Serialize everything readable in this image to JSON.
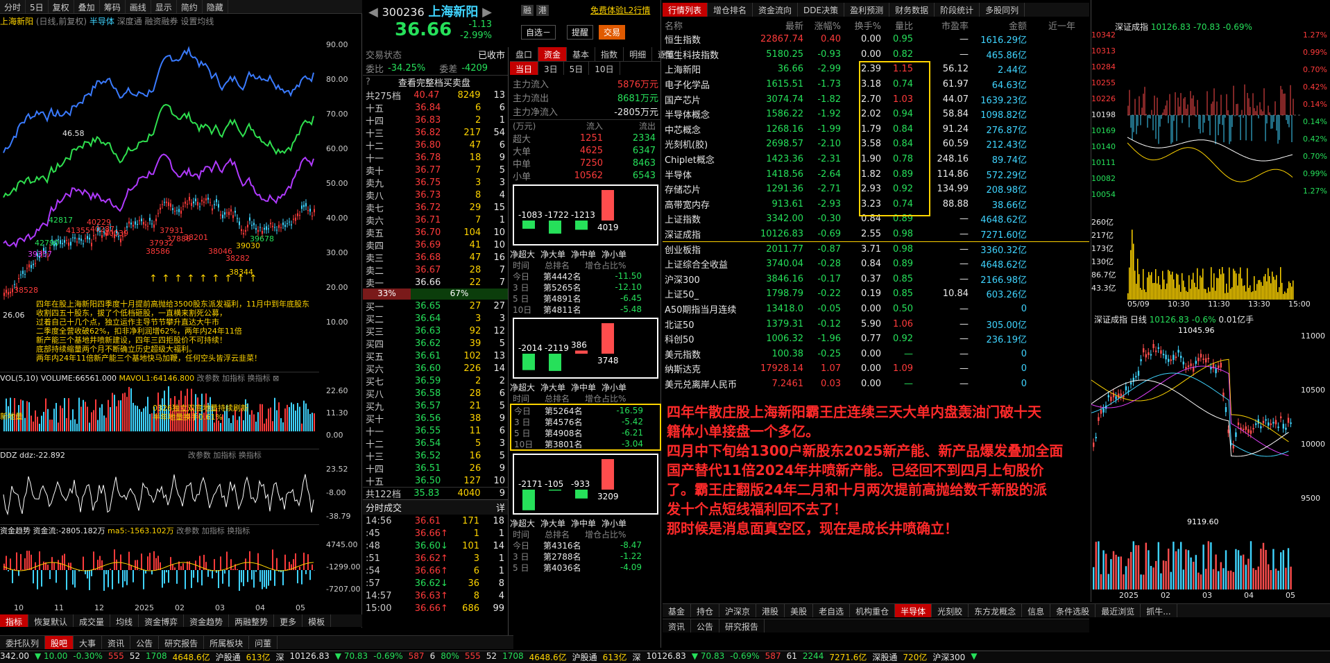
{
  "left": {
    "toolbar": [
      "分时",
      "5日",
      "复权",
      "叠加",
      "筹码",
      "画线",
      "显示",
      "简约",
      "隐藏"
    ],
    "header": {
      "title": "上海新阳",
      "mode": "(日线,前复权)",
      "concept": "半导体",
      "tabs": [
        "深度通",
        "融资融券",
        "设置均线"
      ]
    },
    "yaxis": [
      "90.00",
      "80.00",
      "70.00",
      "60.00",
      "50.00",
      "40.00",
      "30.00",
      "20.00",
      "10.00"
    ],
    "price_labels": [
      {
        "t": "46.58",
        "c": "w"
      },
      {
        "t": "42817",
        "c": "g"
      },
      {
        "t": "41355",
        "c": "r"
      },
      {
        "t": "40287",
        "c": "r"
      },
      {
        "t": "40229",
        "c": "r"
      },
      {
        "t": "40039",
        "c": "r"
      },
      {
        "t": "42790",
        "c": "g"
      },
      {
        "t": "39357",
        "c": "m"
      },
      {
        "t": "38528",
        "c": "r"
      },
      {
        "t": "38586",
        "c": "r"
      },
      {
        "t": "37932",
        "c": "r"
      },
      {
        "t": "37886",
        "c": "r"
      },
      {
        "t": "38201",
        "c": "r"
      },
      {
        "t": "38046",
        "c": "r"
      },
      {
        "t": "38282",
        "c": "r"
      },
      {
        "t": "39030",
        "c": "y"
      },
      {
        "t": "38344",
        "c": "y"
      },
      {
        "t": "39678",
        "c": "g"
      },
      {
        "t": "26.06",
        "c": "w"
      },
      {
        "t": "37931",
        "c": "r"
      }
    ],
    "annotation": [
      "四年在股上海新阳四季度十月提前高抛给3500股东派发福利，11月中到年底股东收割四五十股东，拔了个低档砸股，一直横来割死公募，",
      "过着自己十几个点，独立运作主导节节攀升直达大牛市",
      "二季度全营收破62%，扣非净利润增62%，两年内24年11倍",
      "新产能三个基地井喷新建设，四年三四拒股价不可持续！",
      "底部持续缩量两个月不断确立历史超级大福利。",
      "两年内24年11倍新产能三个基地快马加鞭，任何空头皆浮云韭菜！"
    ],
    "vol": {
      "label": "VOL(5,10)",
      "volume": "VOLUME:66561.000",
      "mavol": "MAVOL1:64146.800",
      "tools": [
        "改参数",
        "加指标",
        "换指标"
      ],
      "y": [
        "22.60",
        "11.30",
        "0.00"
      ],
      "note1": "0326独立双底地量持续刷新",
      "note2": "半年地量换手0.61%",
      "side": "新地量"
    },
    "ddz": {
      "label": "DDZ",
      "val": "ddz:-22.892",
      "tools": [
        "改参数",
        "加指标",
        "换指标"
      ],
      "y": [
        "23.52",
        "-8.00",
        "-38.79"
      ]
    },
    "fund": {
      "label": "资金趋势",
      "val": "资金流:-2805.182万",
      "ma": "ma5:-1563.102万",
      "tools": [
        "改参数",
        "加指标",
        "换指标"
      ],
      "y": [
        "4745.00",
        "-1299.00",
        "-7207.00"
      ]
    },
    "xaxis": [
      "10",
      "11",
      "12",
      "2025",
      "02",
      "03",
      "04",
      "05"
    ],
    "tabs": [
      "指标",
      "恢复默认",
      "成交量",
      "均线",
      "资金博弈",
      "资金趋势",
      "两融整势",
      "更多",
      "模板"
    ]
  },
  "mid": {
    "code": "300236",
    "name": "上海新阳",
    "price": "36.66",
    "change": "-1.13",
    "pct": "-2.99%",
    "tags": [
      "融",
      "港"
    ],
    "free_link": "免费体验L2行情",
    "buttons": [
      "自选－",
      "提醒",
      "交易"
    ],
    "state_label": "交易状态",
    "state": "已收市",
    "wb_label": "委比",
    "wb": "-34.25%",
    "wc_label": "委差",
    "wc": "-4209",
    "tabs": [
      "盘口",
      "资金",
      "基本",
      "指数",
      "明细",
      "逐笔"
    ],
    "view_full": "查看完整档买卖盘",
    "sell_total": {
      "label": "共275档",
      "price": "40.47",
      "vol": "8249",
      "cnt": "13"
    },
    "sells": [
      [
        "十五",
        "36.84",
        "6",
        "6"
      ],
      [
        "十四",
        "36.83",
        "2",
        "1"
      ],
      [
        "十三",
        "36.82",
        "217",
        "54"
      ],
      [
        "十二",
        "36.80",
        "47",
        "6"
      ],
      [
        "十一",
        "36.78",
        "18",
        "9"
      ],
      [
        "卖十",
        "36.77",
        "7",
        "5"
      ],
      [
        "卖九",
        "36.75",
        "3",
        "3"
      ],
      [
        "卖八",
        "36.73",
        "8",
        "4"
      ],
      [
        "卖七",
        "36.72",
        "29",
        "15"
      ],
      [
        "卖六",
        "36.71",
        "7",
        "1"
      ],
      [
        "卖五",
        "36.70",
        "104",
        "10"
      ],
      [
        "卖四",
        "36.69",
        "41",
        "10"
      ],
      [
        "卖三",
        "36.68",
        "47",
        "16"
      ],
      [
        "卖二",
        "36.67",
        "28",
        "7"
      ],
      [
        "卖一",
        "36.66",
        "22",
        "7"
      ]
    ],
    "ratio": [
      "33%",
      "67%"
    ],
    "buys": [
      [
        "买一",
        "36.65",
        "27",
        "27"
      ],
      [
        "买二",
        "36.64",
        "3",
        "3"
      ],
      [
        "买三",
        "36.63",
        "92",
        "12"
      ],
      [
        "买四",
        "36.62",
        "39",
        "5"
      ],
      [
        "买五",
        "36.61",
        "102",
        "13"
      ],
      [
        "买六",
        "36.60",
        "226",
        "14"
      ],
      [
        "买七",
        "36.59",
        "2",
        "2"
      ],
      [
        "买八",
        "36.58",
        "28",
        "6"
      ],
      [
        "买九",
        "36.57",
        "21",
        "5"
      ],
      [
        "买十",
        "36.56",
        "38",
        "9"
      ],
      [
        "十一",
        "36.55",
        "11",
        "6"
      ],
      [
        "十二",
        "36.54",
        "5",
        "3"
      ],
      [
        "十三",
        "36.52",
        "16",
        "5"
      ],
      [
        "十四",
        "36.51",
        "26",
        "9"
      ],
      [
        "十五",
        "36.50",
        "127",
        "10"
      ]
    ],
    "buy_total": {
      "label": "共122档",
      "price": "35.83",
      "vol": "4040",
      "cnt": "9"
    },
    "ticks_title": "分时成交",
    "ticks_btn": "详",
    "ticks": [
      [
        "14:56",
        "36.61",
        "",
        "171",
        "18"
      ],
      [
        ":45",
        "36.66",
        "↑",
        "1",
        "1"
      ],
      [
        ":48",
        "36.60",
        "↓",
        "101",
        "14"
      ],
      [
        ":51",
        "36.62",
        "↑",
        "3",
        "1"
      ],
      [
        ":54",
        "36.66",
        "↑",
        "6",
        "1"
      ],
      [
        ":57",
        "36.62",
        "↓",
        "36",
        "8"
      ],
      [
        "14:57",
        "36.63",
        "↑",
        "8",
        "4"
      ],
      [
        "15:00",
        "36.66",
        "↑",
        "686",
        "99"
      ]
    ],
    "fund": {
      "periods": [
        "当日",
        "3日",
        "5日",
        "10日"
      ],
      "flows": [
        [
          "主力流入",
          "5876万元",
          "r"
        ],
        [
          "主力流出",
          "8681万元",
          "g"
        ],
        [
          "主力净流入",
          "-2805万元",
          "w"
        ]
      ],
      "unit": "(万元)",
      "cols": [
        "流入",
        "流出"
      ],
      "rows": [
        [
          "超大",
          "1251",
          "2334"
        ],
        [
          "大单",
          "4625",
          "6347"
        ],
        [
          "中单",
          "7250",
          "8463"
        ],
        [
          "小单",
          "10562",
          "6543"
        ]
      ],
      "bar_labels": [
        "净超大",
        "净大单",
        "净中单",
        "净小单"
      ],
      "bars1": [
        {
          "v": "-1083",
          "n": -1083
        },
        {
          "v": "-1722",
          "n": -1722
        },
        {
          "v": "-1213",
          "n": -1213
        },
        {
          "v": "4019",
          "n": 4019
        }
      ],
      "rank_hdr": [
        "时间",
        "总排名",
        "增仓占比%"
      ],
      "rank1": [
        [
          "今日",
          "第4442名",
          "-11.50"
        ],
        [
          "3 日",
          "第5265名",
          "-12.10"
        ],
        [
          "5 日",
          "第4891名",
          "-6.45"
        ],
        [
          "10日",
          "第4811名",
          "-5.48"
        ]
      ],
      "bars2": [
        {
          "v": "-2014",
          "n": -2014
        },
        {
          "v": "-2119",
          "n": -2119
        },
        {
          "v": "386",
          "n": 386
        },
        {
          "v": "3748",
          "n": 3748
        }
      ],
      "rank2": [
        [
          "今日",
          "第5264名",
          "-16.59"
        ],
        [
          "3 日",
          "第4576名",
          "-5.42"
        ],
        [
          "5 日",
          "第4908名",
          "-6.21"
        ],
        [
          "10日",
          "第3801名",
          "-3.04"
        ]
      ],
      "bars3": [
        {
          "v": "-2171",
          "n": -2171
        },
        {
          "v": "-105",
          "n": -105
        },
        {
          "v": "-933",
          "n": -933
        },
        {
          "v": "3209",
          "n": 3209
        }
      ],
      "rank3": [
        [
          "今日",
          "第4316名",
          "-8.47"
        ],
        [
          "3 日",
          "第2788名",
          "-1.22"
        ],
        [
          "5 日",
          "第4036名",
          "-4.09"
        ]
      ]
    }
  },
  "table": {
    "tabs": [
      "行情列表",
      "增仓排名",
      "资金流向",
      "DDE决策",
      "盈利预测",
      "财务数据",
      "阶段统计",
      "多股同列"
    ],
    "headers": [
      "名称",
      "最新",
      "涨幅%",
      "换手%",
      "量比",
      "市盈率",
      "金额",
      "近一年"
    ],
    "rows": [
      [
        "恒生指数",
        "22867.74",
        "0.40",
        "0.00",
        "0.95",
        "—",
        "1616.29亿",
        "r"
      ],
      [
        "恒生科技指数",
        "5180.25",
        "-0.93",
        "0.00",
        "0.82",
        "—",
        "465.86亿",
        "g"
      ],
      [
        "上海新阳",
        "36.66",
        "-2.99",
        "2.39",
        "1.15",
        "56.12",
        "2.44亿",
        "g"
      ],
      [
        "电子化学品",
        "1615.51",
        "-1.73",
        "3.18",
        "0.74",
        "61.97",
        "64.63亿",
        "g"
      ],
      [
        "国产芯片",
        "3074.74",
        "-1.82",
        "2.70",
        "1.03",
        "44.07",
        "1639.23亿",
        "g"
      ],
      [
        "半导体概念",
        "1586.22",
        "-1.92",
        "2.02",
        "0.94",
        "58.84",
        "1098.82亿",
        "g"
      ],
      [
        "中芯概念",
        "1268.16",
        "-1.99",
        "1.79",
        "0.84",
        "91.24",
        "276.87亿",
        "g"
      ],
      [
        "光刻机(胶)",
        "2698.57",
        "-2.10",
        "3.58",
        "0.84",
        "60.59",
        "212.43亿",
        "g"
      ],
      [
        "Chiplet概念",
        "1423.36",
        "-2.31",
        "1.90",
        "0.78",
        "248.16",
        "89.74亿",
        "g"
      ],
      [
        "半导体",
        "1418.56",
        "-2.64",
        "1.82",
        "0.89",
        "114.86",
        "572.29亿",
        "g"
      ],
      [
        "存储芯片",
        "1291.36",
        "-2.71",
        "2.93",
        "0.92",
        "134.99",
        "208.98亿",
        "g"
      ],
      [
        "高带宽内存",
        "913.61",
        "-2.93",
        "3.23",
        "0.74",
        "88.88",
        "38.66亿",
        "g"
      ],
      [
        "上证指数",
        "3342.00",
        "-0.30",
        "0.84",
        "0.89",
        "—",
        "4648.62亿",
        "g"
      ],
      [
        "深证成指",
        "10126.83",
        "-0.69",
        "2.55",
        "0.98",
        "—",
        "7271.60亿",
        "g"
      ],
      [
        "创业板指",
        "2011.77",
        "-0.87",
        "3.71",
        "0.98",
        "—",
        "3360.32亿",
        "g"
      ],
      [
        "上证综合全收益",
        "3740.04",
        "-0.28",
        "0.84",
        "0.89",
        "—",
        "4648.62亿",
        "g"
      ],
      [
        "沪深300",
        "3846.16",
        "-0.17",
        "0.37",
        "0.85",
        "—",
        "2166.98亿",
        "g"
      ],
      [
        "上证50_",
        "1798.79",
        "-0.22",
        "0.19",
        "0.85",
        "10.84",
        "603.26亿",
        "g"
      ],
      [
        "A50期指当月连续",
        "13418.0",
        "-0.05",
        "0.00",
        "0.50",
        "—",
        "0",
        "g"
      ],
      [
        "北证50",
        "1379.31",
        "-0.12",
        "5.90",
        "1.06",
        "—",
        "305.00亿",
        "g"
      ],
      [
        "科创50",
        "1006.32",
        "-1.96",
        "0.77",
        "0.92",
        "—",
        "236.19亿",
        "g"
      ],
      [
        "美元指数",
        "100.38",
        "-0.25",
        "0.00",
        "—",
        "—",
        "0",
        "g"
      ],
      [
        "纳斯达克",
        "17928.14",
        "1.07",
        "0.00",
        "1.09",
        "—",
        "0",
        "r"
      ],
      [
        "美元兑离岸人民币",
        "7.2461",
        "0.03",
        "0.00",
        "—",
        "—",
        "0",
        "r"
      ]
    ],
    "note": [
      "四年牛散庄股上海新阳霸王庄连续三天大单内盘轰油门破十天",
      "籍体小单接盘一个多亿。",
      "四月中下旬给1300户新股东2025新产能、新产品爆发叠加全面",
      "国产替代11倍2024年井喷新产能。已经回不到四月上旬股价",
      "了。霸王庄翻版24年二月和十月两次提前高抛给数千新股的派",
      "发十个点短线福利回不去了！",
      "那时候是消息面真空区，现在是成长井喷确立！"
    ],
    "bottom_tabs": [
      "基金",
      "持仓",
      "沪深京",
      "港股",
      "美股",
      "老自选",
      "机构重仓",
      "半导体",
      "光刻胶",
      "东方龙概念",
      "信息",
      "条件选股",
      "最近浏览",
      "抓牛..."
    ],
    "sub_tabs": [
      "资讯",
      "公告",
      "研究报告"
    ]
  },
  "right": {
    "title": "深证成指",
    "price": "10126.83",
    "chg": "-70.83",
    "pct": "-0.69%",
    "yleft": [
      "10342",
      "10313",
      "10284",
      "10255",
      "10226",
      "10198",
      "10169",
      "10140",
      "10111",
      "10082",
      "10054"
    ],
    "yright": [
      "1.27%",
      "0.99%",
      "0.70%",
      "0.42%",
      "0.14%",
      "0.14%",
      "0.42%",
      "0.70%",
      "0.99%",
      "1.27%"
    ],
    "vol_y": [
      "260亿",
      "217亿",
      "173亿",
      "130亿",
      "86.7亿",
      "43.3亿"
    ],
    "xaxis": [
      "05/09",
      "10:30",
      "11:30",
      "13:30",
      "15:00"
    ],
    "day_title": "深证成指 日线",
    "day_price": "10126.83",
    "day_chg": "-0.6%",
    "day_amt": "0.01亿手",
    "day_y": [
      "11000",
      "10500",
      "10000",
      "9500"
    ],
    "hi": "11045.96",
    "lo": "9119.60",
    "day_x": [
      "2025",
      "02",
      "03",
      "04",
      "05"
    ]
  },
  "status": {
    "bottom_tabs": [
      "委托队列",
      "股吧",
      "大事",
      "资讯",
      "公告",
      "研究报告",
      "所属板块",
      "问董"
    ],
    "items": [
      {
        "t": "342.00",
        "c": "w"
      },
      {
        "t": "▼ 10.00",
        "c": "g"
      },
      {
        "t": "-0.30%",
        "c": "g"
      },
      {
        "t": "555",
        "c": "r"
      },
      {
        "t": "52",
        "c": "w"
      },
      {
        "t": "1708",
        "c": "g"
      },
      {
        "t": "4648.6亿",
        "c": "y"
      },
      {
        "t": "沪股通",
        "c": "w"
      },
      {
        "t": "613亿",
        "c": "y"
      },
      {
        "t": "深",
        "c": "w"
      },
      {
        "t": "10126.83",
        "c": "w"
      },
      {
        "t": "▼ 70.83",
        "c": "g"
      },
      {
        "t": "-0.69%",
        "c": "g"
      },
      {
        "t": "587",
        "c": "r"
      },
      {
        "t": "6",
        "c": "w"
      },
      {
        "t": "80%",
        "c": "g"
      },
      {
        "t": "555",
        "c": "r"
      },
      {
        "t": "52",
        "c": "w"
      },
      {
        "t": "1708",
        "c": "g"
      },
      {
        "t": "4648.6亿",
        "c": "y"
      },
      {
        "t": "沪股通",
        "c": "w"
      },
      {
        "t": "613亿",
        "c": "y"
      },
      {
        "t": "深",
        "c": "w"
      },
      {
        "t": "10126.83",
        "c": "w"
      },
      {
        "t": "▼ 70.83",
        "c": "g"
      },
      {
        "t": "-0.69%",
        "c": "g"
      },
      {
        "t": "587",
        "c": "r"
      },
      {
        "t": "61",
        "c": "w"
      },
      {
        "t": "2244",
        "c": "g"
      },
      {
        "t": "7271.6亿",
        "c": "y"
      },
      {
        "t": "深股通",
        "c": "w"
      },
      {
        "t": "720亿",
        "c": "y"
      },
      {
        "t": "沪深300",
        "c": "w"
      },
      {
        "t": "▼",
        "c": "g"
      }
    ],
    "right_btn": "▶ 条件选股 ▷ 最近浏览 ▷ 抓牛..."
  }
}
